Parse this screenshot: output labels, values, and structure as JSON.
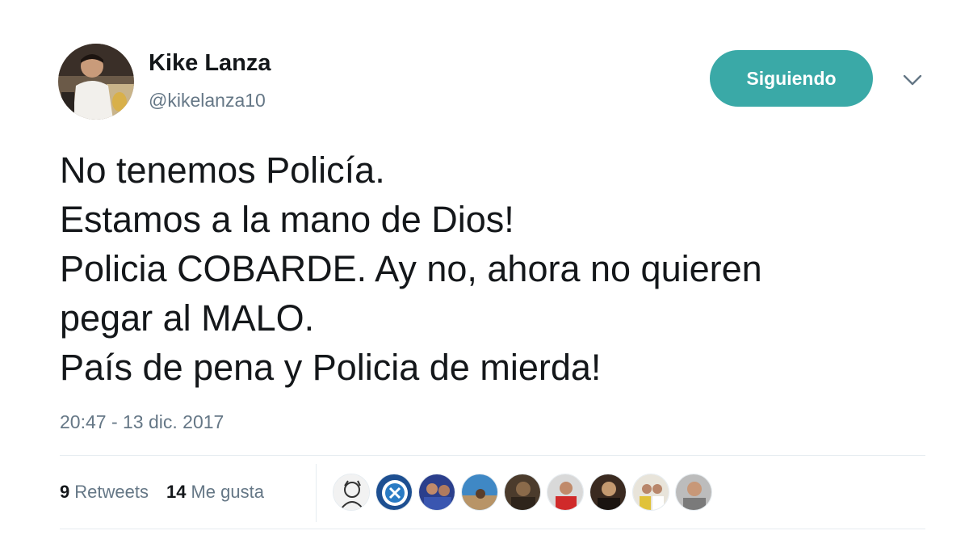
{
  "author": {
    "name": "Kike Lanza",
    "handle": "@kikelanza10",
    "avatar_icon": "profile-photo"
  },
  "follow_button": {
    "label": "Siguiendo",
    "color": "#3aa9a7"
  },
  "menu_icon": "chevron-down-icon",
  "tweet": {
    "lines": [
      "No tenemos Policía.",
      "Estamos a la mano de Dios!",
      "Policia COBARDE. Ay no, ahora no quieren",
      "pegar al MALO.",
      "País de pena y Policia de mierda!"
    ],
    "timestamp": "20:47 - 13 dic. 2017"
  },
  "stats": {
    "retweets_count": "9",
    "retweets_label": "Retweets",
    "likes_count": "14",
    "likes_label": "Me gusta"
  },
  "likers": [
    {
      "icon": "liker-avatar-1"
    },
    {
      "icon": "liker-avatar-2"
    },
    {
      "icon": "liker-avatar-3"
    },
    {
      "icon": "liker-avatar-4"
    },
    {
      "icon": "liker-avatar-5"
    },
    {
      "icon": "liker-avatar-6"
    },
    {
      "icon": "liker-avatar-7"
    },
    {
      "icon": "liker-avatar-8"
    },
    {
      "icon": "liker-avatar-9"
    }
  ]
}
